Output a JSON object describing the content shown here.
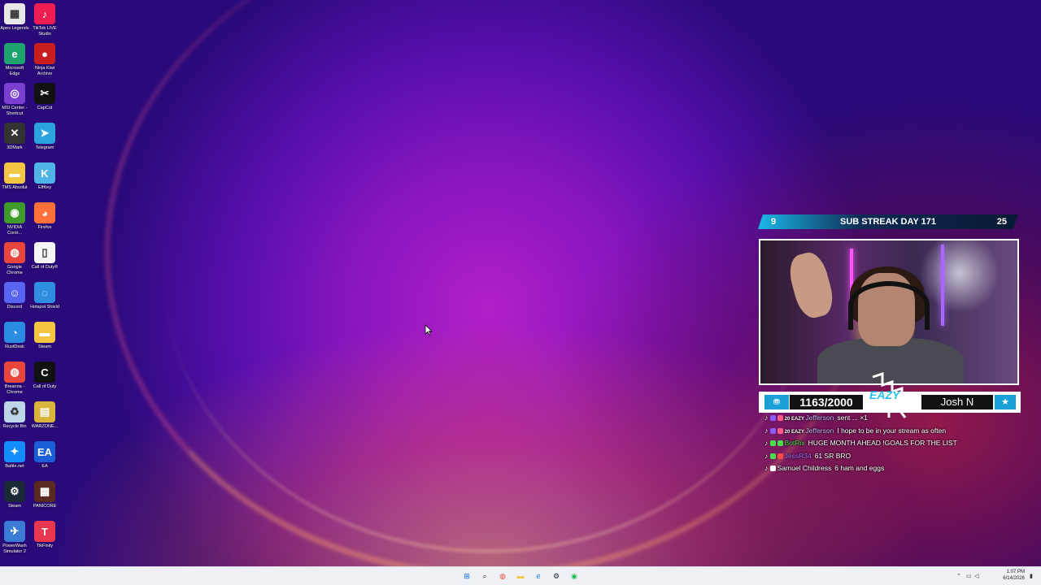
{
  "desktop": {
    "icons_col1": [
      {
        "label": "Apex Legends",
        "icon": "apex-icon",
        "color": "#e8e8e8",
        "glyph": "▦"
      },
      {
        "label": "Microsoft Edge",
        "icon": "edge-icon",
        "color": "#1fa36e",
        "glyph": "e"
      },
      {
        "label": "MSI Center - Shortcut",
        "icon": "msi-icon",
        "color": "#7a3fd1",
        "glyph": "◎"
      },
      {
        "label": "3DMark",
        "icon": "3dmark-icon",
        "color": "#333333",
        "glyph": "✕"
      },
      {
        "label": "TMS Absolut",
        "icon": "folder-icon",
        "color": "#f4c542",
        "glyph": "▬"
      },
      {
        "label": "NVIDIA Contr...",
        "icon": "nvidia-icon",
        "color": "#3f9a2a",
        "glyph": "◉"
      },
      {
        "label": "Google Chrome",
        "icon": "chrome-icon",
        "color": "#e8453c",
        "glyph": "◍"
      },
      {
        "label": "Discord",
        "icon": "discord-icon",
        "color": "#5865f2",
        "glyph": "☺"
      },
      {
        "label": "RustDesk",
        "icon": "rustdesk-icon",
        "color": "#2a8ce0",
        "glyph": "◔"
      },
      {
        "label": "Breanna - Chrome",
        "icon": "chrome-profile-icon",
        "color": "#e8453c",
        "glyph": "◍"
      },
      {
        "label": "Recycle Bin",
        "icon": "recycle-bin-icon",
        "color": "#bcd6e8",
        "glyph": "♻"
      },
      {
        "label": "Battle.net",
        "icon": "battlenet-icon",
        "color": "#148eff",
        "glyph": "✦"
      },
      {
        "label": "Steam",
        "icon": "steam-icon",
        "color": "#1b2838",
        "glyph": "⚙"
      },
      {
        "label": "PowerWash Simulator 2",
        "icon": "powerwash-icon",
        "color": "#3a7bd5",
        "glyph": "✈"
      }
    ],
    "icons_col2": [
      {
        "label": "TikTok LIVE Studio",
        "icon": "tiktok-live-icon",
        "color": "#ee1d52",
        "glyph": "♪"
      },
      {
        "label": "Ninja Kiwi Archive",
        "icon": "ninjakiwi-icon",
        "color": "#c81e1e",
        "glyph": "●"
      },
      {
        "label": "CapCut",
        "icon": "capcut-icon",
        "color": "#111111",
        "glyph": "✂"
      },
      {
        "label": "Telegram",
        "icon": "telegram-icon",
        "color": "#2aa3df",
        "glyph": "➤"
      },
      {
        "label": "ElfKey",
        "icon": "elfkey-icon",
        "color": "#4fb3e8",
        "glyph": "K"
      },
      {
        "label": "Firefox",
        "icon": "firefox-icon",
        "color": "#ff7139",
        "glyph": "◕"
      },
      {
        "label": "Call of Duty®",
        "icon": "file-icon",
        "color": "#f5f5f5",
        "glyph": "▯"
      },
      {
        "label": "Hotspot Shield",
        "icon": "hotspot-icon",
        "color": "#2f8ee0",
        "glyph": "◌"
      },
      {
        "label": "Steam",
        "icon": "folder-icon",
        "color": "#f4c542",
        "glyph": "▬"
      },
      {
        "label": "Call of Duty",
        "icon": "cod-icon",
        "color": "#111111",
        "glyph": "C"
      },
      {
        "label": "WARZONE...",
        "icon": "warzone-icon",
        "color": "#d9b43a",
        "glyph": "▤"
      },
      {
        "label": "EA",
        "icon": "ea-icon",
        "color": "#1b5fd8",
        "glyph": "EA"
      },
      {
        "label": "PANICORE",
        "icon": "panicore-icon",
        "color": "#5a2a20",
        "glyph": "▩"
      },
      {
        "label": "TikFinity",
        "icon": "tikfinity-icon",
        "color": "#e8374e",
        "glyph": "T"
      }
    ]
  },
  "overlay": {
    "streak_left": "9",
    "streak_title": "SUB STREAK DAY 171",
    "streak_right": "25",
    "goal_icon_glyph": "⛃",
    "goal_count": "1163/2000",
    "goal_logo_text": "EAZY",
    "goal_name": "Josh N",
    "goal_star": "★"
  },
  "chat": [
    {
      "user": "Jefferson",
      "user_color": "#c9b6ff",
      "badge_colors": [
        "#8a5cff",
        "#ff5c8a"
      ],
      "prefix": "20 EAZY",
      "message": "sent ... ×1"
    },
    {
      "user": "Jefferson",
      "user_color": "#c9b6ff",
      "badge_colors": [
        "#8a5cff",
        "#ff5c8a"
      ],
      "prefix": "20 EAZY",
      "message": "I hope to be in your stream as often"
    },
    {
      "user": "BotRix",
      "user_color": "#46e04a",
      "badge_colors": [
        "#46e04a",
        "#46e04a"
      ],
      "prefix": "",
      "message": "HUGE MONTH AHEAD !GOALS FOR THE LIST"
    },
    {
      "user": "JessR34",
      "user_color": "#b06cff",
      "badge_colors": [
        "#46e04a",
        "#ff4a4a"
      ],
      "prefix": "",
      "message": "61 SR BRO"
    },
    {
      "user": "Samuel Childress",
      "user_color": "#ffffff",
      "badge_colors": [
        "#ffffff"
      ],
      "prefix": "",
      "message": "6  ham and eggs"
    }
  ],
  "taskbar": {
    "icons": [
      {
        "name": "start-icon",
        "color": "#0a6cf0",
        "glyph": "⊞"
      },
      {
        "name": "search-icon",
        "color": "#333333",
        "glyph": "⌕"
      },
      {
        "name": "chrome-icon",
        "color": "#e8453c",
        "glyph": "◍"
      },
      {
        "name": "file-explorer-icon",
        "color": "#f4c542",
        "glyph": "▬"
      },
      {
        "name": "edge-icon",
        "color": "#1f88e5",
        "glyph": "e"
      },
      {
        "name": "steam-icon",
        "color": "#1b2838",
        "glyph": "⚙"
      },
      {
        "name": "spotify-icon",
        "color": "#1db954",
        "glyph": "◉"
      }
    ],
    "time": "1:07 PM",
    "date": "6/14/2026"
  }
}
